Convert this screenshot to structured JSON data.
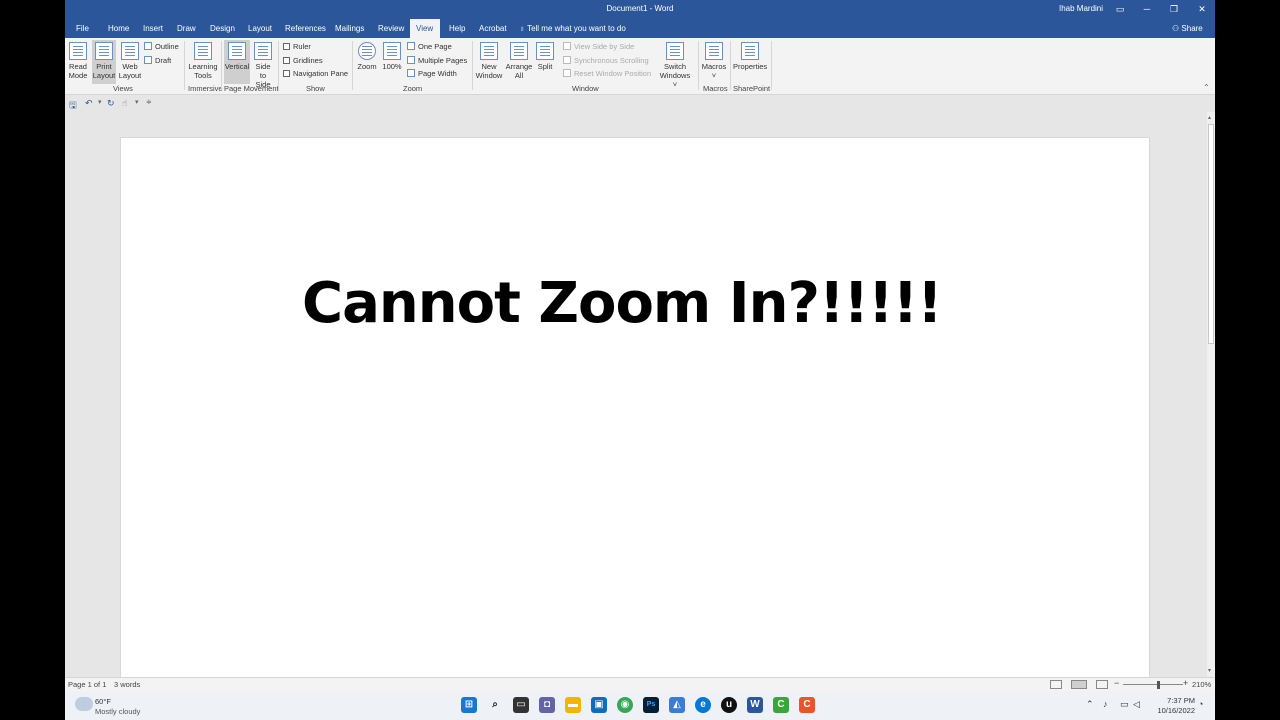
{
  "window": {
    "title": "Document1  -  Word",
    "user": "Ihab Mardini",
    "tell_me": "Tell me what you want to do",
    "share": "Share"
  },
  "tabs": [
    "File",
    "Home",
    "Insert",
    "Draw",
    "Design",
    "Layout",
    "References",
    "Mailings",
    "Review",
    "View",
    "Help",
    "Acrobat"
  ],
  "active_tab": "View",
  "ribbon": {
    "views": {
      "read_mode": [
        "Read",
        "Mode"
      ],
      "print_layout": [
        "Print",
        "Layout"
      ],
      "web_layout": [
        "Web",
        "Layout"
      ],
      "outline": "Outline",
      "draft": "Draft",
      "group": "Views"
    },
    "immersive": {
      "learning_tools": [
        "Learning",
        "Tools"
      ],
      "group": "Immersive"
    },
    "page_movement": {
      "vertical": "Vertical",
      "side_to_side": [
        "Side",
        "to Side"
      ],
      "group": "Page Movement"
    },
    "show": {
      "ruler": "Ruler",
      "gridlines": "Gridlines",
      "navigation_pane": "Navigation Pane",
      "group": "Show"
    },
    "zoom": {
      "zoom": "Zoom",
      "hundred": "100%",
      "one_page": "One Page",
      "multiple_pages": "Multiple Pages",
      "page_width": "Page Width",
      "group": "Zoom"
    },
    "window": {
      "new_window": [
        "New",
        "Window"
      ],
      "arrange_all": [
        "Arrange",
        "All"
      ],
      "split": "Split",
      "view_side_by_side": "View Side by Side",
      "synchronous_scrolling": "Synchronous Scrolling",
      "reset_window_position": "Reset Window Position",
      "switch_windows": [
        "Switch",
        "Windows ˅"
      ],
      "group": "Window"
    },
    "macros": {
      "macros": [
        "Macros",
        "˅"
      ],
      "group": "Macros"
    },
    "sharepoint": {
      "properties": "Properties",
      "group": "SharePoint"
    }
  },
  "document": {
    "text": "Cannot Zoom In?!!!!!"
  },
  "status": {
    "page": "Page 1 of 1",
    "words": "3 words",
    "zoom": "210%"
  },
  "taskbar": {
    "weather_temp": "60°F",
    "weather_desc": "Mostly cloudy",
    "time": "7:37 PM",
    "date": "10/16/2022"
  }
}
